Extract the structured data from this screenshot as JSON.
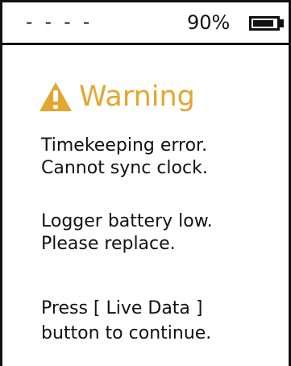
{
  "status": {
    "left_text": "- - - -",
    "battery_percent": "90%",
    "battery_level": 0.9
  },
  "warning": {
    "title": "Warning",
    "icon": "warning-triangle-icon",
    "accent_color": "#e3a72f"
  },
  "messages": [
    "Timekeeping error.",
    "Cannot sync clock.",
    "Logger battery low.",
    "Please replace.",
    "Press [ Live Data ]",
    "button to continue."
  ]
}
